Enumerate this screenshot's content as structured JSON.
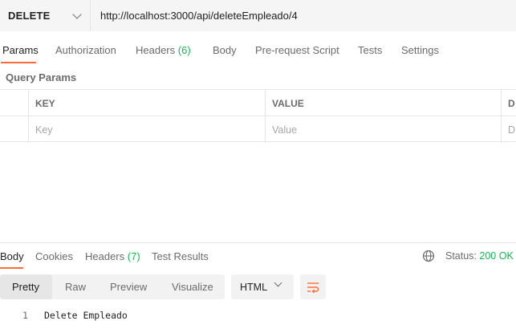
{
  "request": {
    "method": "DELETE",
    "url": "http://localhost:3000/api/deleteEmpleado/4"
  },
  "request_tabs": [
    {
      "label": "Params",
      "active": true
    },
    {
      "label": "Authorization"
    },
    {
      "label": "Headers",
      "count": "(6)"
    },
    {
      "label": "Body"
    },
    {
      "label": "Pre-request Script"
    },
    {
      "label": "Tests"
    },
    {
      "label": "Settings"
    }
  ],
  "query_params": {
    "title": "Query Params",
    "columns": [
      "KEY",
      "VALUE",
      "D"
    ],
    "placeholders": [
      "Key",
      "Value",
      "D"
    ]
  },
  "response_tabs": [
    {
      "label": "Body",
      "active": true
    },
    {
      "label": "Cookies"
    },
    {
      "label": "Headers",
      "count": "(7)"
    },
    {
      "label": "Test Results"
    }
  ],
  "status": {
    "label": "Status:",
    "value": "200 OK",
    "icon": "globe-icon"
  },
  "view_modes": [
    "Pretty",
    "Raw",
    "Preview",
    "Visualize"
  ],
  "active_view": "Pretty",
  "language": "HTML",
  "wrap_icon": "wrap-lines-icon",
  "response_body": [
    {
      "line": "1",
      "text": "Delete Empleado"
    }
  ],
  "colors": {
    "accent": "#ff6c37",
    "success": "#0cbb52",
    "muted": "#6b6b6b"
  }
}
